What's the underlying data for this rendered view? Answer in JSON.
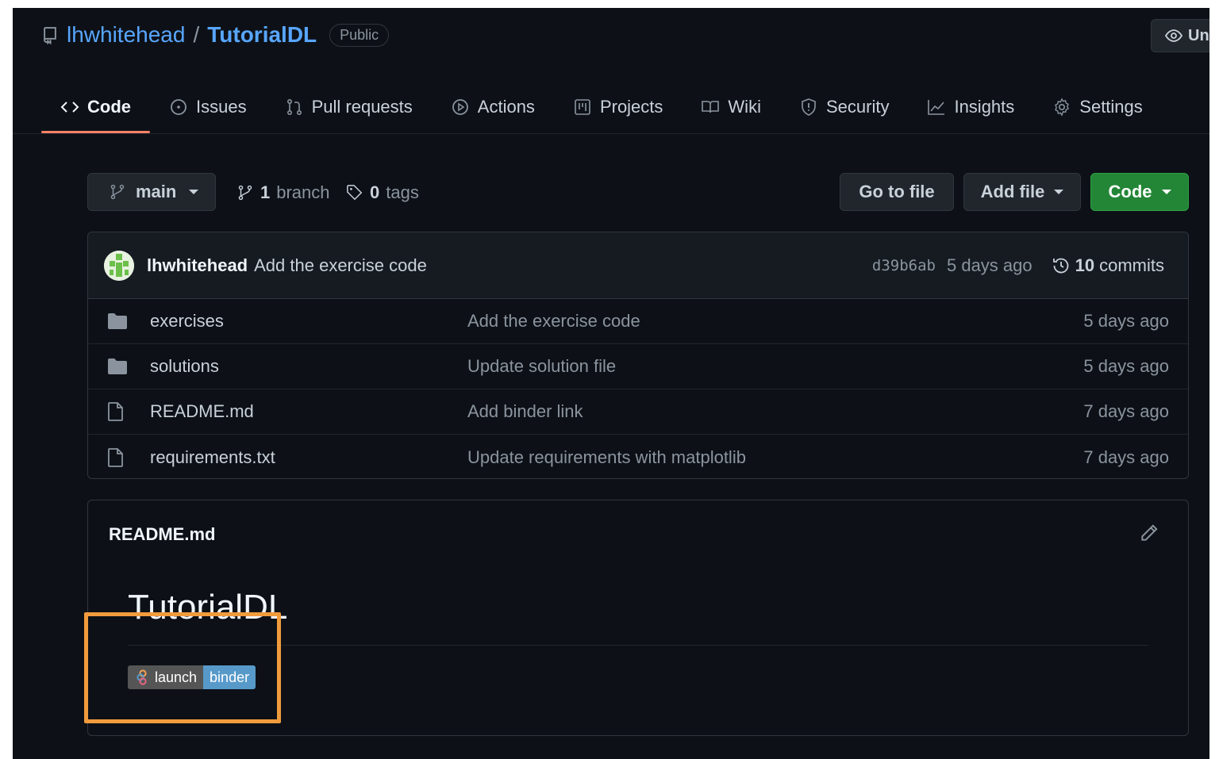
{
  "repo": {
    "owner": "lhwhitehead",
    "separator": "/",
    "name": "TutorialDL",
    "visibility": "Public",
    "watch_label": "Un"
  },
  "tabs": [
    {
      "label": "Code",
      "icon": "code-icon",
      "active": true
    },
    {
      "label": "Issues",
      "icon": "issue-icon"
    },
    {
      "label": "Pull requests",
      "icon": "pull-request-icon"
    },
    {
      "label": "Actions",
      "icon": "play-icon"
    },
    {
      "label": "Projects",
      "icon": "project-icon"
    },
    {
      "label": "Wiki",
      "icon": "book-icon"
    },
    {
      "label": "Security",
      "icon": "shield-icon"
    },
    {
      "label": "Insights",
      "icon": "graph-icon"
    },
    {
      "label": "Settings",
      "icon": "gear-icon"
    }
  ],
  "toolbar": {
    "branch": "main",
    "branch_count": "1",
    "branch_label": "branch",
    "tag_count": "0",
    "tag_label": "tags",
    "go_to_file": "Go to file",
    "add_file": "Add file",
    "code": "Code"
  },
  "latest_commit": {
    "author": "lhwhitehead",
    "message": "Add the exercise code",
    "sha": "d39b6ab",
    "time": "5 days ago",
    "commit_count": "10",
    "commit_label": "commits"
  },
  "files": [
    {
      "type": "folder",
      "name": "exercises",
      "commit": "Add the exercise code",
      "time": "5 days ago"
    },
    {
      "type": "folder",
      "name": "solutions",
      "commit": "Update solution file",
      "time": "5 days ago"
    },
    {
      "type": "file",
      "name": "README.md",
      "commit": "Add binder link",
      "time": "7 days ago"
    },
    {
      "type": "file",
      "name": "requirements.txt",
      "commit": "Update requirements with matplotlib",
      "time": "7 days ago"
    }
  ],
  "readme": {
    "filename": "README.md",
    "title": "TutorialDL",
    "badge_left": "launch",
    "badge_right": "binder"
  },
  "colors": {
    "background": "#0d1117",
    "link": "#58a6ff",
    "accent_tab": "#f78166",
    "code_button": "#238636",
    "highlight": "#f19b3c",
    "binder_blue": "#579aca"
  }
}
